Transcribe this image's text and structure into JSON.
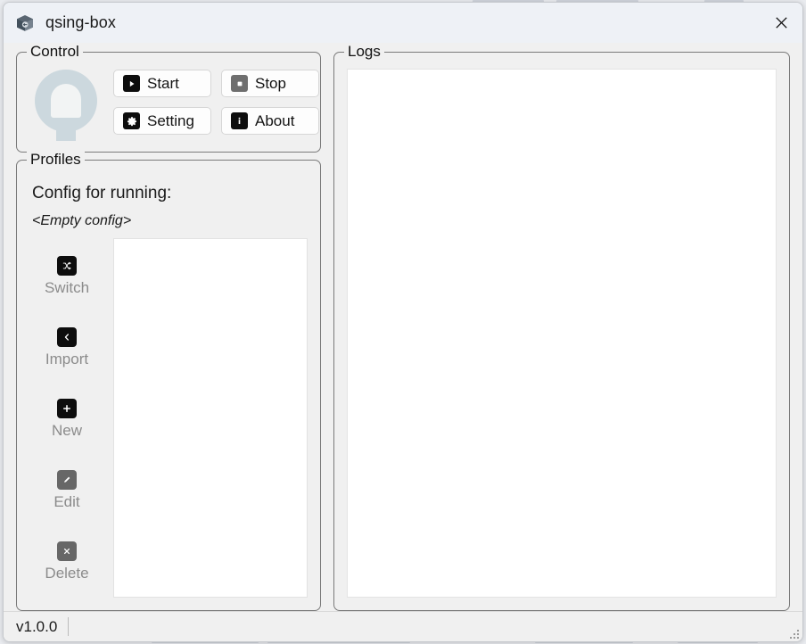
{
  "window": {
    "title": "qsing-box",
    "app_icon": "box-3d-icon",
    "close_label": "close-icon"
  },
  "control": {
    "legend": "Control",
    "logo_icon": "qsing-box-mascot-icon",
    "buttons": [
      {
        "label": "Start",
        "icon": "play-icon",
        "state": "enabled"
      },
      {
        "label": "Stop",
        "icon": "stop-icon",
        "state": "disabled"
      },
      {
        "label": "Setting",
        "icon": "gear-icon",
        "state": "enabled"
      },
      {
        "label": "About",
        "icon": "info-icon",
        "state": "enabled"
      }
    ]
  },
  "profiles": {
    "legend": "Profiles",
    "config_label": "Config for running:",
    "config_value": "<Empty config>",
    "actions": [
      {
        "label": "Switch",
        "icon": "shuffle-icon",
        "state": "enabled"
      },
      {
        "label": "Import",
        "icon": "chevron-left-icon",
        "state": "enabled"
      },
      {
        "label": "New",
        "icon": "plus-icon",
        "state": "enabled"
      },
      {
        "label": "Edit",
        "icon": "pencil-icon",
        "state": "disabled"
      },
      {
        "label": "Delete",
        "icon": "close-x-icon",
        "state": "disabled"
      }
    ],
    "list_items": []
  },
  "logs": {
    "legend": "Logs",
    "content": ""
  },
  "status": {
    "version": "v1.0.0",
    "grip_icon": "resize-grip-icon"
  },
  "colors": {
    "window_bg": "#f0f0f0",
    "titlebar_bg": "#eef1f6",
    "group_border": "#7a7a7a",
    "icon_enabled": "#0d0d0d",
    "icon_disabled": "#6e6e6e",
    "label_muted": "#8b8b8b",
    "logo": "#ccd8de"
  }
}
